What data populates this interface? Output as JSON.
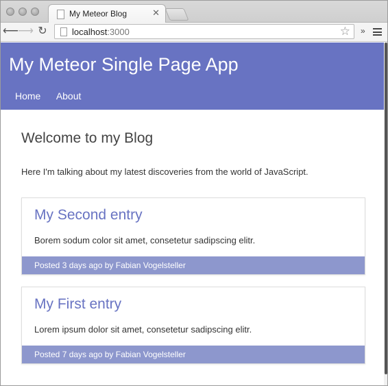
{
  "browser": {
    "tab_title": "My Meteor Blog",
    "tab_close": "✕",
    "url_host": "localhost",
    "url_port": ":3000",
    "icons": [
      "back-icon",
      "forward-icon",
      "reload-icon",
      "star-icon",
      "menu-icon"
    ]
  },
  "header": {
    "title": "My Meteor Single Page App",
    "nav": [
      {
        "label": "Home"
      },
      {
        "label": "About"
      }
    ],
    "color": "#6873c2"
  },
  "main": {
    "heading": "Welcome to my Blog",
    "intro": "Here I'm talking about my latest discoveries from the world of JavaScript."
  },
  "posts": [
    {
      "title": "My Second entry",
      "body": "Borem sodum color sit amet, consetetur sadipscing elitr.",
      "meta": "Posted 3 days ago by Fabian Vogelsteller"
    },
    {
      "title": "My First entry",
      "body": "Lorem ipsum dolor sit amet, consetetur sadipscing elitr.",
      "meta": "Posted 7 days ago by Fabian Vogelsteller"
    }
  ],
  "colors": {
    "accent": "#6873c2",
    "footer": "#8d97cd"
  }
}
